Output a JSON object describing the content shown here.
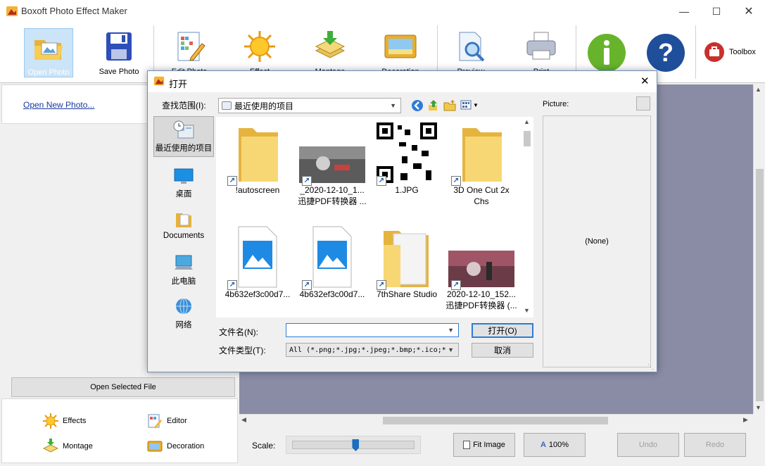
{
  "app": {
    "title": "Boxoft Photo Effect Maker",
    "accent": "#cce4f7"
  },
  "toolbar": {
    "open_photo": "Open Photo",
    "save_photo": "Save Photo",
    "edit_photo": "Edit Photo",
    "effect": "Effect",
    "montage": "Montage",
    "decoration": "Decoration",
    "preview": "Preview",
    "print": "Print",
    "toolbox": "Toolbox"
  },
  "left": {
    "open_new": "Open New Photo...",
    "open_selected": "Open Selected File",
    "effects": "Effects",
    "editor": "Editor",
    "montage": "Montage",
    "decoration": "Decoration"
  },
  "bottom": {
    "scale_label": "Scale:",
    "scale_value": 0.52,
    "fit_image": "Fit Image",
    "zoom_100": "100%",
    "undo": "Undo",
    "redo": "Redo"
  },
  "dialog": {
    "title": "打开",
    "lookin_label": "查找范围(I):",
    "lookin_value": "最近使用的项目",
    "picture_label": "Picture:",
    "picture_none": "(None)",
    "places": [
      {
        "label": "最近使用的项目"
      },
      {
        "label": "桌面"
      },
      {
        "label": "Documents"
      },
      {
        "label": "此电脑"
      },
      {
        "label": "网络"
      }
    ],
    "files": [
      {
        "line1": "!autoscreen",
        "line2": ""
      },
      {
        "line1": "_2020-12-10_1...",
        "line2": "迅捷PDF转换器 ..."
      },
      {
        "line1": "1.JPG",
        "line2": ""
      },
      {
        "line1": "3D One Cut 2x",
        "line2": "Chs"
      },
      {
        "line1": "4b632ef3c00d7...",
        "line2": ""
      },
      {
        "line1": "4b632ef3c00d7...",
        "line2": ""
      },
      {
        "line1": "7thShare Studio",
        "line2": ""
      },
      {
        "line1": "2020-12-10_152...",
        "line2": "迅捷PDF转换器 (..."
      }
    ],
    "filename_label": "文件名(N):",
    "filename_value": "",
    "filetype_label": "文件类型(T):",
    "filetype_value": "All (*.png;*.jpg;*.jpeg;*.bmp;*.ico;*",
    "open_button": "打开(O)",
    "cancel_button": "取消"
  }
}
